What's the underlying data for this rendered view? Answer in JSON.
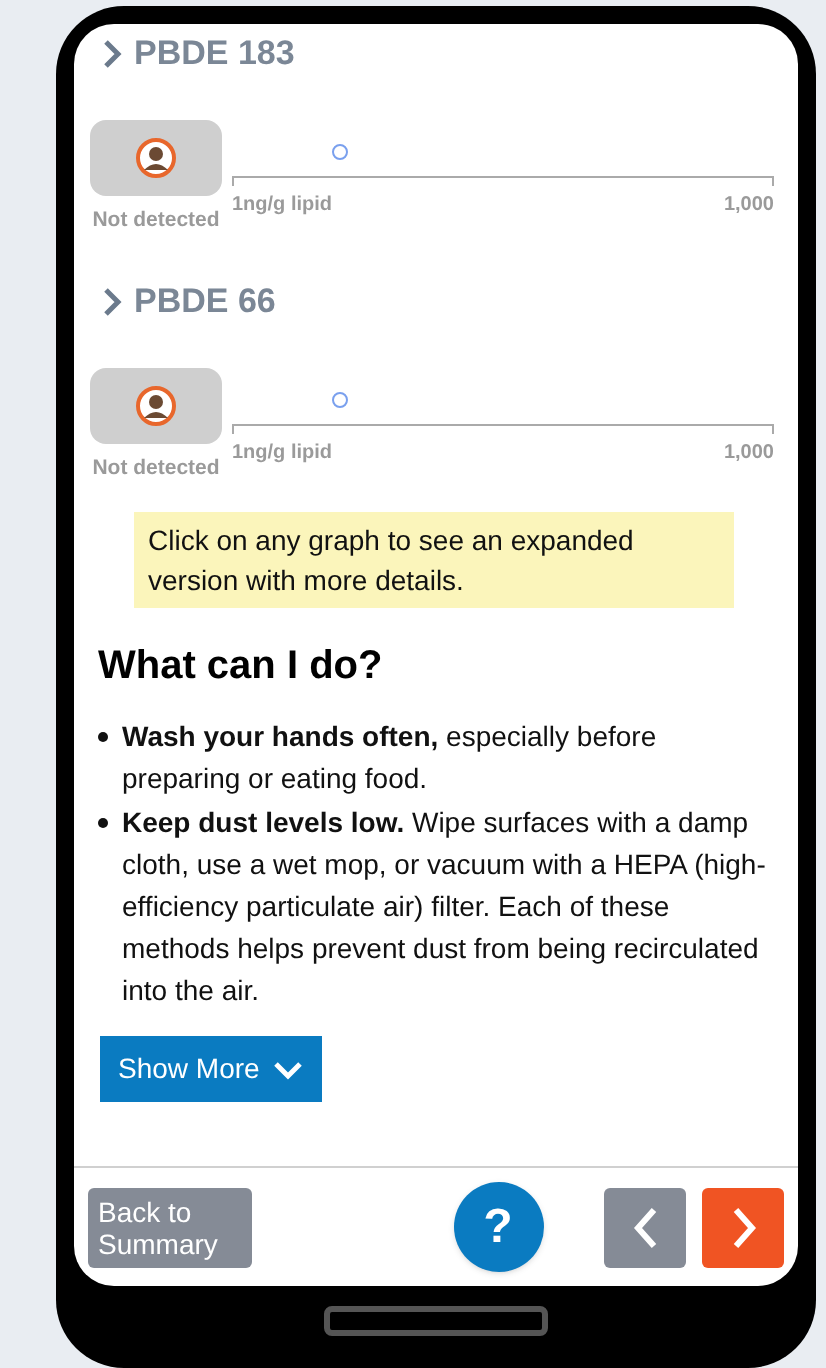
{
  "results": [
    {
      "title": "PBDE 183",
      "status": "Not detected",
      "axis_min": "1ng/g lipid",
      "axis_max": "1,000",
      "level": 0.2
    },
    {
      "title": "PBDE 66",
      "status": "Not detected",
      "axis_min": "1ng/g lipid",
      "axis_max": "1,000",
      "level": 0.2
    }
  ],
  "tip": "Click on any graph to see an expanded version with more details.",
  "section": {
    "heading": "What can I do?",
    "items": [
      "**Wash your hands often,** especially before preparing or eating food.",
      "**Keep dust levels low.** Wipe surfaces with a damp cloth, use a wet mop, or vacuum with a HEPA (high-efficiency particulate air) filter. Each of these methods helps prevent dust from being recirculated into the air."
    ],
    "more_button": "Show More"
  },
  "footer": {
    "back": "Back to Summary",
    "help": "?"
  }
}
